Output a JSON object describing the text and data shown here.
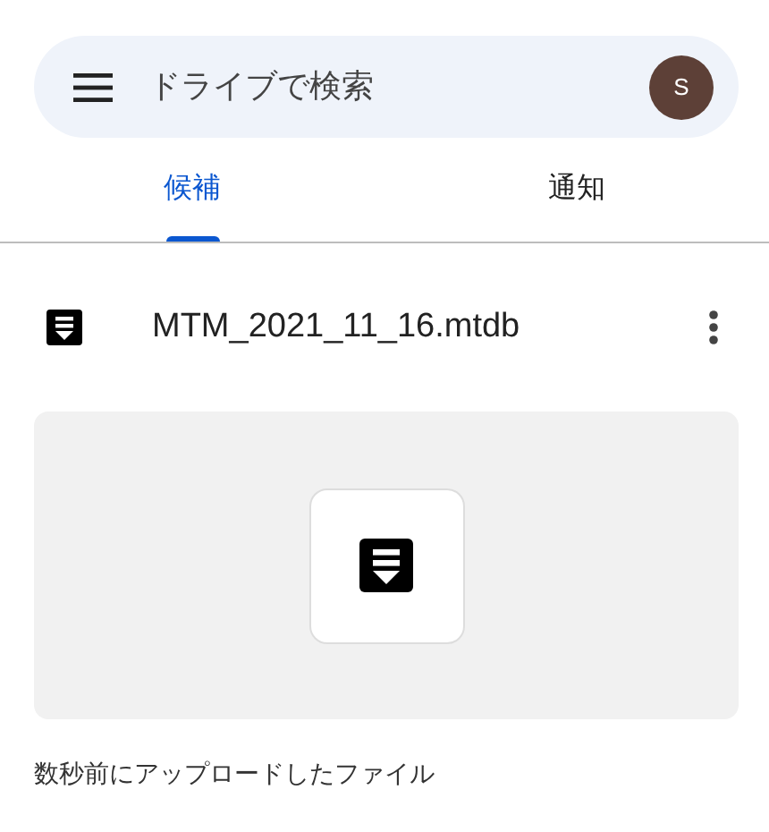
{
  "search": {
    "placeholder": "ドライブで検索",
    "avatar": "S"
  },
  "tabs": [
    {
      "label": "候補",
      "selected": true
    },
    {
      "label": "通知",
      "selected": false
    }
  ],
  "file": {
    "name": "MTM_2021_11_16.mtdb",
    "caption": "数秒前にアップロードしたファイル"
  }
}
